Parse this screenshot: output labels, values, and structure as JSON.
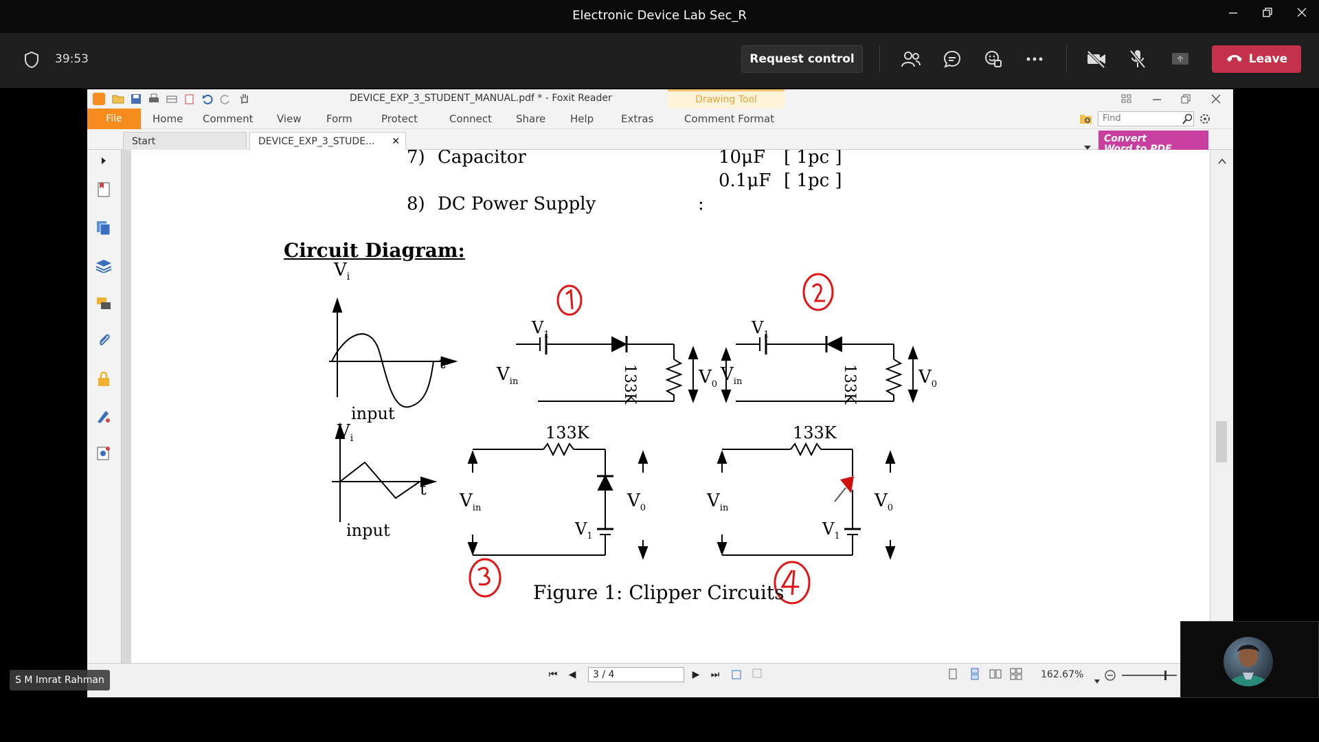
{
  "teams": {
    "window_title": "Electronic Device Lab Sec_R",
    "timer": "39:53",
    "request_control": "Request control",
    "leave": "Leave",
    "participant_name": "S M Imrat Rahman"
  },
  "foxit": {
    "title": "DEVICE_EXP_3_STUDENT_MANUAL.pdf * - Foxit Reader",
    "drawing_tool": "Drawing Tool",
    "menu": {
      "file": "File",
      "items": [
        "Home",
        "Comment",
        "View",
        "Form",
        "Protect",
        "Connect",
        "Share",
        "Help",
        "Extras",
        "Comment Format"
      ]
    },
    "find_placeholder": "Find",
    "tabs": [
      "Start",
      "DEVICE_EXP_3_STUDE..."
    ],
    "convert": {
      "line1": "Convert",
      "line2": "Word to PDF"
    },
    "page_indicator": "3 / 4",
    "zoom": "162.67%"
  },
  "document": {
    "items": [
      {
        "num": "7)",
        "name": "Capacitor",
        "values": [
          "10μF",
          "0.1μF"
        ],
        "qty": [
          "[  1pc ]",
          "[  1pc ]"
        ]
      },
      {
        "num": "8)",
        "name": "DC Power Supply",
        "sep": ":"
      }
    ],
    "section_heading": "Circuit Diagram:",
    "figure_caption": "Figure 1: Clipper Circuits",
    "labels": {
      "vi": "V",
      "vi_sub": "i",
      "t": "t",
      "input": "input",
      "v1": "V",
      "v1_sub": "1",
      "vin": "V",
      "vin_sub": "in",
      "vo": "V",
      "vo_sub": "0",
      "resistor": "133K"
    },
    "annotations": [
      "1",
      "2",
      "3",
      "4"
    ]
  }
}
